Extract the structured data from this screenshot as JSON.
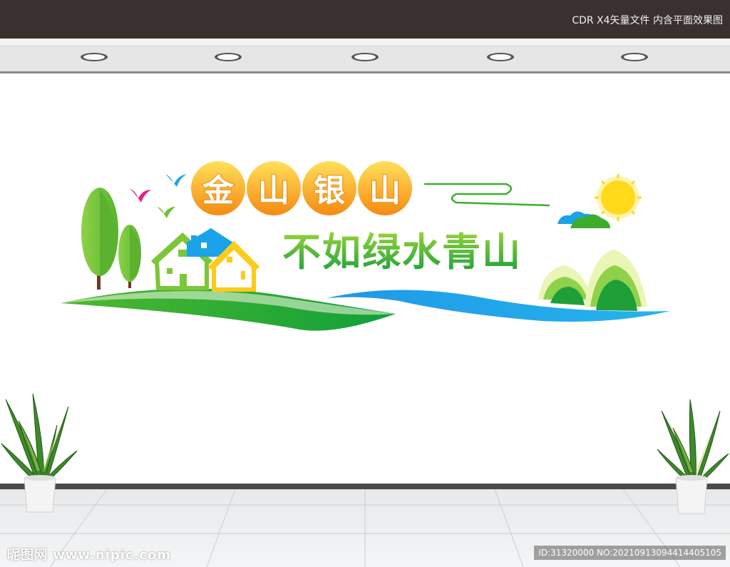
{
  "header": {
    "label": "CDR X4矢量文件  内含平面效果图"
  },
  "artwork": {
    "line1": [
      "金",
      "山",
      "银",
      "山"
    ],
    "line2": "不如绿水青山"
  },
  "watermark": {
    "left": "昵图网 www.nipic.com",
    "right": "ID:31320000 NO:20210913094414405105"
  },
  "colors": {
    "orange": "#f7a41d",
    "green": "#3cae2b",
    "lime": "#8cc63f",
    "blue": "#1aa3e8",
    "sun": "#ffd91a"
  }
}
